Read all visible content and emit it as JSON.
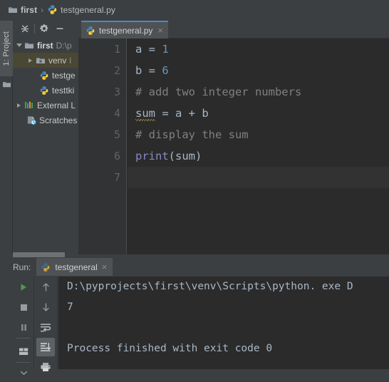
{
  "navbar": {
    "project_crumb": "first",
    "separator": "›",
    "file_crumb": "testgeneral.py"
  },
  "tool_window_tab": {
    "label": "1: Project",
    "folder_icon": "folder-icon"
  },
  "project_panel": {
    "toolbar": [
      {
        "name": "collapse-all-button",
        "icon": "collapse-all-icon"
      },
      {
        "name": "settings-button",
        "icon": "gear-icon"
      },
      {
        "name": "hide-button",
        "icon": "minimize-icon"
      }
    ],
    "tree": [
      {
        "label": "first",
        "path": "D:\\p",
        "icon": "folder-icon",
        "expanded": true,
        "indent": 0,
        "selected": false,
        "has_arrow": true,
        "bold": true
      },
      {
        "label": "venv",
        "path": "l",
        "icon": "venv-folder-icon",
        "expanded": false,
        "indent": 1,
        "selected": true,
        "has_arrow": true,
        "bold": false
      },
      {
        "label": "testge",
        "path": "",
        "icon": "python-file-icon",
        "expanded": false,
        "indent": 2,
        "selected": false,
        "has_arrow": false,
        "bold": false
      },
      {
        "label": "testtki",
        "path": "",
        "icon": "python-file-icon",
        "expanded": false,
        "indent": 2,
        "selected": false,
        "has_arrow": false,
        "bold": false
      },
      {
        "label": "External L",
        "path": "",
        "icon": "external-libraries-icon",
        "expanded": false,
        "indent": 0,
        "selected": false,
        "has_arrow": true,
        "bold": false
      },
      {
        "label": "Scratches",
        "path": "",
        "icon": "scratches-icon",
        "expanded": false,
        "indent": 1,
        "selected": false,
        "has_arrow": false,
        "bold": false
      }
    ]
  },
  "editor": {
    "tab": {
      "label": "testgeneral.py",
      "icon": "python-file-icon",
      "close": "×"
    },
    "line_numbers": [
      "1",
      "2",
      "3",
      "4",
      "5",
      "6",
      "7"
    ],
    "current_line": 7,
    "lines": [
      {
        "n": 1,
        "tokens": [
          {
            "t": "a",
            "c": "def"
          },
          {
            "t": " = ",
            "c": "op"
          },
          {
            "t": "1",
            "c": "num"
          }
        ]
      },
      {
        "n": 2,
        "tokens": [
          {
            "t": "b",
            "c": "def"
          },
          {
            "t": " = ",
            "c": "op"
          },
          {
            "t": "6",
            "c": "num"
          }
        ]
      },
      {
        "n": 3,
        "tokens": [
          {
            "t": "# add two integer numbers",
            "c": "cmt"
          }
        ]
      },
      {
        "n": 4,
        "tokens": [
          {
            "t": "sum",
            "c": "warn"
          },
          {
            "t": " = a + b",
            "c": "def"
          }
        ]
      },
      {
        "n": 5,
        "tokens": [
          {
            "t": "# display the sum",
            "c": "cmt"
          }
        ]
      },
      {
        "n": 6,
        "tokens": [
          {
            "t": "print",
            "c": "kw"
          },
          {
            "t": "(sum)",
            "c": "def"
          }
        ]
      },
      {
        "n": 7,
        "tokens": []
      }
    ]
  },
  "run_panel": {
    "title": "Run:",
    "tab": {
      "label": "testgeneral",
      "icon": "python-icon",
      "close": "×"
    },
    "toolbar_left": [
      {
        "name": "rerun-button",
        "icon": "play-icon"
      },
      {
        "name": "stop-button",
        "icon": "stop-icon"
      },
      {
        "name": "pause-button",
        "icon": "pause-icon"
      },
      {
        "name": "restore-layout-button",
        "icon": "layout-icon"
      }
    ],
    "toolbar_right": [
      {
        "name": "up-stacktrace-button",
        "icon": "arrow-up-icon"
      },
      {
        "name": "down-stacktrace-button",
        "icon": "arrow-down-icon"
      },
      {
        "name": "soft-wrap-button",
        "icon": "soft-wrap-icon"
      },
      {
        "name": "scroll-to-end-button",
        "icon": "scroll-to-end-icon",
        "active": true
      },
      {
        "name": "print-button",
        "icon": "printer-icon"
      }
    ],
    "console_lines": [
      "D:\\pyprojects\\first\\venv\\Scripts\\python. exe D",
      "7",
      "",
      "Process finished with exit code 0"
    ]
  },
  "colors": {
    "panel_bg": "#3c3f41",
    "editor_bg": "#2b2b2b",
    "gutter_bg": "#313335",
    "tab_active_bg": "#4e5254",
    "tab_accent": "#4a88c7",
    "selection_bg": "#4a4733",
    "number_token": "#6897bb",
    "comment_token": "#808080",
    "keyword_token": "#8888c6",
    "default_token": "#a9b7c6",
    "run_green": "#4f9a4f"
  }
}
